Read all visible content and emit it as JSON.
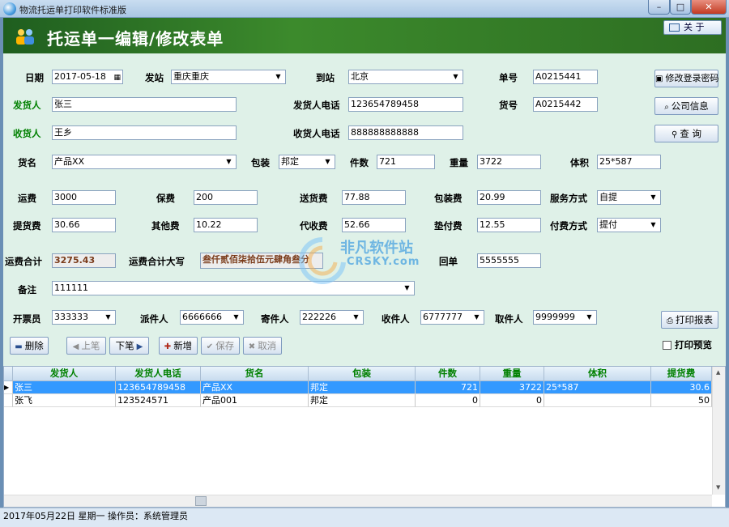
{
  "window": {
    "title": "物流托运单打印软件标准版",
    "min_glyph": "–",
    "max_glyph": "□",
    "close_glyph": "✕"
  },
  "header": {
    "title": "托运单一编辑/修改表单",
    "about_label": "关 于"
  },
  "form": {
    "date_label": "日期",
    "date_value": "2017-05-18",
    "from_label": "发站",
    "from_value": "重庆重庆",
    "to_label": "到站",
    "to_value": "北京",
    "order_no_label": "单号",
    "order_no_value": "A0215441",
    "sender_label": "发货人",
    "sender_value": "张三",
    "sender_phone_label": "发货人电话",
    "sender_phone_value": "123654789458",
    "goods_no_label": "货号",
    "goods_no_value": "A0215442",
    "receiver_label": "收货人",
    "receiver_value": "王乡",
    "receiver_phone_label": "收货人电话",
    "receiver_phone_value": "888888888888",
    "goods_name_label": "货名",
    "goods_name_value": "产品XX",
    "packing_label": "包装",
    "packing_value": "邦定",
    "pieces_label": "件数",
    "pieces_value": "721",
    "weight_label": "重量",
    "weight_value": "3722",
    "volume_label": "体积",
    "volume_value": "25*587",
    "freight_label": "运费",
    "freight_value": "3000",
    "insurance_label": "保费",
    "insurance_value": "200",
    "delivery_fee_label": "送货费",
    "delivery_fee_value": "77.88",
    "packing_fee_label": "包装费",
    "packing_fee_value": "20.99",
    "service_label": "服务方式",
    "service_value": "自提",
    "pickup_fee_label": "提货费",
    "pickup_fee_value": "30.66",
    "other_fee_label": "其他费",
    "other_fee_value": "10.22",
    "collect_fee_label": "代收费",
    "collect_fee_value": "52.66",
    "advance_fee_label": "垫付费",
    "advance_fee_value": "12.55",
    "payment_label": "付费方式",
    "payment_value": "提付",
    "total_label": "运费合计",
    "total_value": "3275.43",
    "total_upper_label": "运费合计大写",
    "total_upper_value": "叁仟贰佰柒拾伍元肆角叁分",
    "receipt_label": "回单",
    "receipt_value": "5555555",
    "remark_label": "备注",
    "remark_value": "111111",
    "issuer_label": "开票员",
    "issuer_value": "333333",
    "dispatcher_label": "派件人",
    "dispatcher_value": "6666666",
    "shipper_label": "寄件人",
    "shipper_value": "222226",
    "recipient_label": "收件人",
    "recipient_value": "6777777",
    "collector_label": "取件人",
    "collector_value": "9999999"
  },
  "side_buttons": {
    "change_password": "修改登录密码",
    "company_info": "公司信息",
    "query": "查 询",
    "print_report": "打印报表"
  },
  "toolbar": {
    "delete": "删除",
    "prev": "上笔",
    "next": "下笔",
    "add": "新增",
    "save": "保存",
    "cancel": "取消",
    "print_preview": "打印预览"
  },
  "grid": {
    "columns": [
      "发货人",
      "发货人电话",
      "货名",
      "包装",
      "件数",
      "重量",
      "体积",
      "提货费"
    ],
    "rows": [
      [
        "张三",
        "123654789458",
        "产品XX",
        "邦定",
        "721",
        "3722",
        "25*587",
        "30.6"
      ],
      [
        "张飞",
        "123524571",
        "产品001",
        "邦定",
        "0",
        "0",
        "",
        "50"
      ]
    ]
  },
  "status": {
    "text": "2017年05月22日  星期一  操作员：系统管理员"
  },
  "watermark": {
    "cn": "非凡软件站",
    "en": "CRSKY.com"
  },
  "colors": {
    "banner": "#2d6e22",
    "form_bg": "#dff1e8",
    "selected_row": "#3399ff",
    "label_green": "#008000"
  }
}
